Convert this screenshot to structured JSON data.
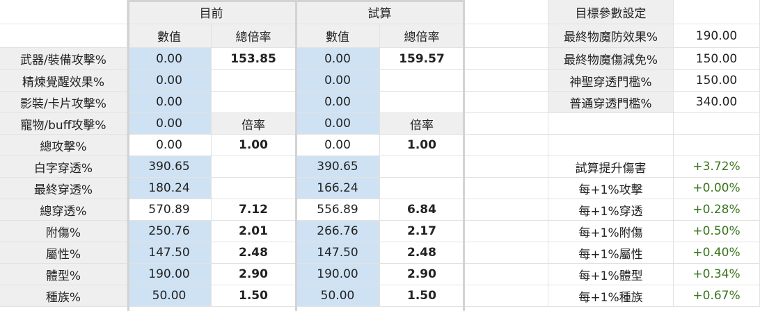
{
  "headers": {
    "current": "目前",
    "trial": "試算",
    "value": "數值",
    "total_ratio": "總倍率",
    "ratio": "倍率",
    "target_settings": "目標參數設定"
  },
  "rows": [
    {
      "label": "武器/裝備攻擊%",
      "cur": "0.00",
      "cur_r": "153.85",
      "tri": "0.00",
      "tri_r": "159.57"
    },
    {
      "label": "精煉覺醒效果%",
      "cur": "0.00",
      "cur_r": "",
      "tri": "0.00",
      "tri_r": ""
    },
    {
      "label": "影裝/卡片攻擊%",
      "cur": "0.00",
      "cur_r": "",
      "tri": "0.00",
      "tri_r": ""
    },
    {
      "label": "寵物/buff攻擊%",
      "cur": "0.00",
      "cur_r": "",
      "tri": "0.00",
      "tri_r": ""
    },
    {
      "label": "總攻擊%",
      "cur": "0.00",
      "cur_r": "1.00",
      "tri": "0.00",
      "tri_r": "1.00"
    },
    {
      "label": "白字穿透%",
      "cur": "390.65",
      "cur_r": "",
      "tri": "390.65",
      "tri_r": ""
    },
    {
      "label": "最終穿透%",
      "cur": "180.24",
      "cur_r": "",
      "tri": "166.24",
      "tri_r": ""
    },
    {
      "label": "總穿透%",
      "cur": "570.89",
      "cur_r": "7.12",
      "tri": "556.89",
      "tri_r": "6.84"
    },
    {
      "label": "附傷%",
      "cur": "250.76",
      "cur_r": "2.01",
      "tri": "266.76",
      "tri_r": "2.17"
    },
    {
      "label": "屬性%",
      "cur": "147.50",
      "cur_r": "2.48",
      "tri": "147.50",
      "tri_r": "2.48"
    },
    {
      "label": "體型%",
      "cur": "190.00",
      "cur_r": "2.90",
      "tri": "190.00",
      "tri_r": "2.90"
    },
    {
      "label": "種族%",
      "cur": "50.00",
      "cur_r": "1.50",
      "tri": "50.00",
      "tri_r": "1.50"
    }
  ],
  "targets": [
    {
      "label": "最終物魔防效果%",
      "value": "190.00"
    },
    {
      "label": "最終物魔傷減免%",
      "value": "150.00"
    },
    {
      "label": "神聖穿透門檻%",
      "value": "150.00"
    },
    {
      "label": "普通穿透門檻%",
      "value": "340.00"
    }
  ],
  "results": [
    {
      "label": "試算提升傷害",
      "value": "+3.72%"
    },
    {
      "label": "每+1%攻擊",
      "value": "+0.00%"
    },
    {
      "label": "每+1%穿透",
      "value": "+0.28%"
    },
    {
      "label": "每+1%附傷",
      "value": "+0.50%"
    },
    {
      "label": "每+1%屬性",
      "value": "+0.40%"
    },
    {
      "label": "每+1%體型",
      "value": "+0.34%"
    },
    {
      "label": "每+1%種族",
      "value": "+0.67%"
    }
  ],
  "colors": {
    "header_gray": "#efefef",
    "input_blue": "#cfe2f3",
    "positive_green": "#38761d"
  }
}
